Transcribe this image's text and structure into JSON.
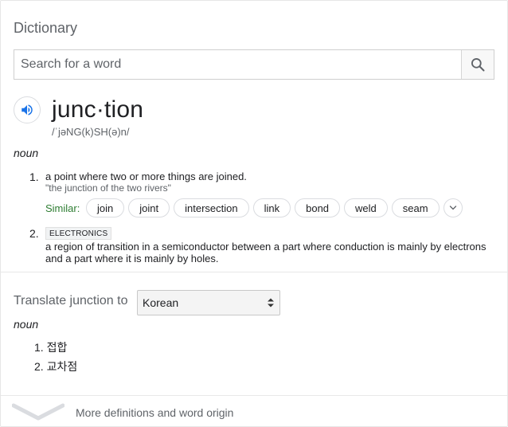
{
  "card_title": "Dictionary",
  "search": {
    "placeholder": "Search for a word",
    "value": ""
  },
  "entry": {
    "word": "junc·tion",
    "phonetic": "/ˈjəNG(k)SH(ə)n/",
    "part_of_speech": "noun",
    "definitions": [
      {
        "number": "1.",
        "text": "a point where two or more things are joined.",
        "example": "\"the junction of the two rivers\"",
        "similar_label": "Similar:",
        "similar": [
          "join",
          "joint",
          "intersection",
          "link",
          "bond",
          "weld",
          "seam"
        ]
      },
      {
        "number": "2.",
        "domain_tag": "ELECTRONICS",
        "text": "a region of transition in a semiconductor between a part where conduction is mainly by electrons and a part where it is mainly by holes."
      }
    ]
  },
  "translate": {
    "label": "Translate junction to",
    "selected_language": "Korean",
    "part_of_speech": "noun",
    "items": [
      {
        "number": "1.",
        "text": "접합"
      },
      {
        "number": "2.",
        "text": "교차점"
      }
    ]
  },
  "more_link": "More definitions and word origin",
  "icons": {
    "search": "search-icon",
    "speaker": "speaker-icon",
    "expand": "chevron-down-icon",
    "select": "select-arrows-icon",
    "more": "chevron-down-icon"
  },
  "colors": {
    "accent": "#1a73e8",
    "similar_label": "#2e7d32",
    "muted": "#5f6368"
  }
}
